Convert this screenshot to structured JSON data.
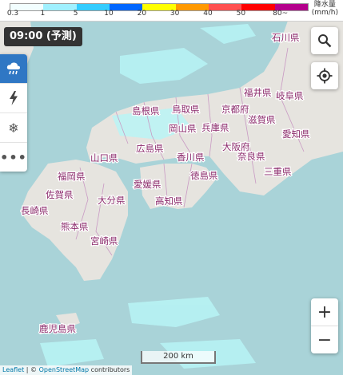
{
  "legend": {
    "ticks": [
      "0.3",
      "1",
      "5",
      "10",
      "20",
      "30",
      "40",
      "50",
      "80~"
    ],
    "unit_line1": "降水量",
    "unit_line2": "(mm/h)",
    "colors": [
      "#f2feff",
      "#a0f0ff",
      "#33ccff",
      "#0066ff",
      "#ffff00",
      "#ff9900",
      "#ff5050",
      "#ff0000",
      "#b4008c"
    ]
  },
  "time_badge": "09:00 (予測)",
  "side_buttons": [
    {
      "icon": "rain-cloud-icon",
      "active": true
    },
    {
      "icon": "lightning-icon",
      "active": false
    },
    {
      "icon": "snowflake-icon",
      "active": false
    },
    {
      "icon": "more-icon",
      "active": false
    }
  ],
  "zoom": {
    "in_label": "+",
    "out_label": "−"
  },
  "scale_label": "200 km",
  "attribution": {
    "leaflet": "Leaflet",
    "sep": " | © ",
    "osm": "OpenStreetMap",
    "suffix": " contributors"
  },
  "prefectures": {
    "ishikawa": "石川県",
    "fukui": "福井県",
    "gifu": "岐阜県",
    "shimane": "島根県",
    "tottori": "鳥取県",
    "kyoto": "京都府",
    "shiga": "滋賀県",
    "okayama": "岡山県",
    "hyogo": "兵庫県",
    "aichi": "愛知県",
    "yamaguchi": "山口県",
    "hiroshima": "広島県",
    "osaka": "大阪府",
    "nara": "奈良県",
    "kagawa": "香川県",
    "fukuoka": "福岡県",
    "tokushima": "徳島県",
    "ehime": "愛媛県",
    "mie": "三重県",
    "saga": "佐賀県",
    "oita": "大分県",
    "kochi": "高知県",
    "nagasaki": "長崎県",
    "kumamoto": "熊本県",
    "miyazaki": "宮崎県",
    "kagoshima": "鹿児島県"
  }
}
